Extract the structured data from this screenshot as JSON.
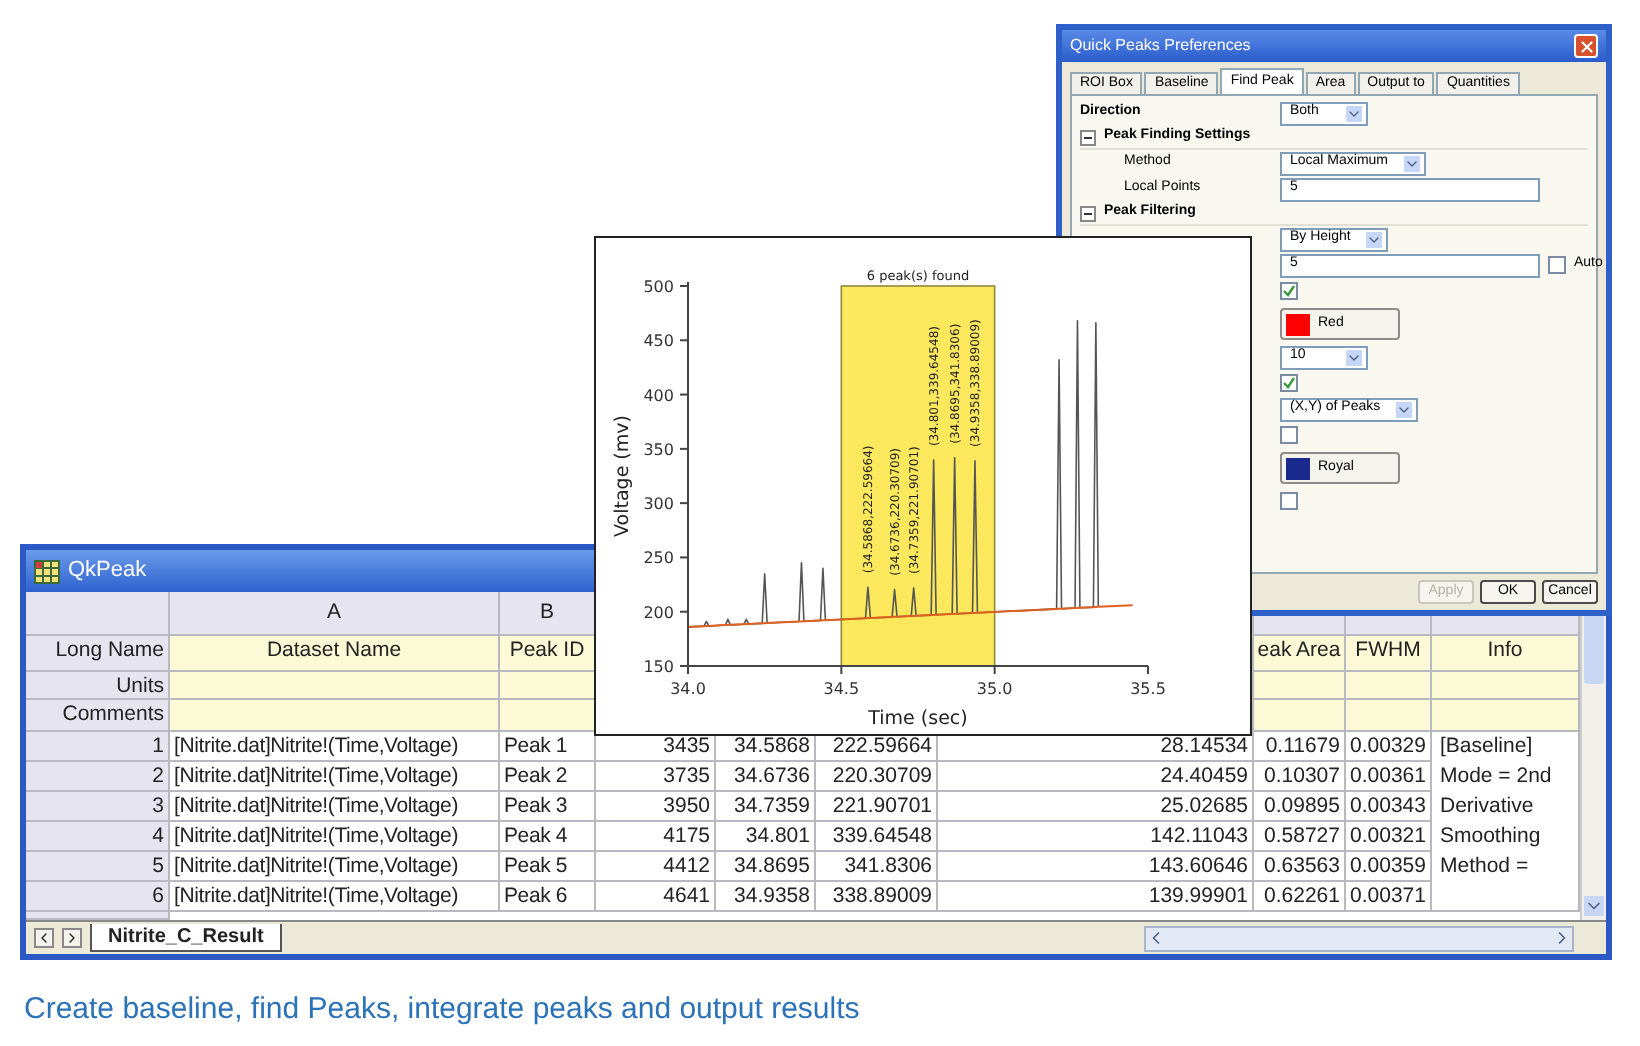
{
  "worksheet": {
    "title": "QkPeak",
    "left_columns": [
      {
        "letter": "A",
        "long_name": "Dataset Name"
      },
      {
        "letter": "B",
        "long_name": "Peak ID"
      }
    ],
    "right_columns": [
      {
        "long_name": "eak Area"
      },
      {
        "long_name": "FWHM"
      },
      {
        "long_name": "Info"
      }
    ],
    "row_labels": [
      "Long Name",
      "Units",
      "Comments"
    ],
    "rows": [
      {
        "number": "1",
        "cells": [
          "[Nitrite.dat]Nitrite!(Time,Voltage)",
          "Peak 1",
          "3435",
          "34.5868",
          "222.59664",
          "28.14534",
          "0.11679",
          "0.00329"
        ]
      },
      {
        "number": "2",
        "cells": [
          "[Nitrite.dat]Nitrite!(Time,Voltage)",
          "Peak 2",
          "3735",
          "34.6736",
          "220.30709",
          "24.40459",
          "0.10307",
          "0.00361"
        ]
      },
      {
        "number": "3",
        "cells": [
          "[Nitrite.dat]Nitrite!(Time,Voltage)",
          "Peak 3",
          "3950",
          "34.7359",
          "221.90701",
          "25.02685",
          "0.09895",
          "0.00343"
        ]
      },
      {
        "number": "4",
        "cells": [
          "[Nitrite.dat]Nitrite!(Time,Voltage)",
          "Peak 4",
          "4175",
          "34.801",
          "339.64548",
          "142.11043",
          "0.58727",
          "0.00321"
        ]
      },
      {
        "number": "5",
        "cells": [
          "[Nitrite.dat]Nitrite!(Time,Voltage)",
          "Peak 5",
          "4412",
          "34.8695",
          "341.8306",
          "143.60646",
          "0.63563",
          "0.00359"
        ]
      },
      {
        "number": "6",
        "cells": [
          "[Nitrite.dat]Nitrite!(Time,Voltage)",
          "Peak 6",
          "4641",
          "34.9358",
          "338.89009",
          "139.99901",
          "0.62261",
          "0.00371"
        ]
      }
    ],
    "info_note": "[Baseline] Mode = 2nd Derivative Smoothing Method =",
    "sheet_tab": "Nitrite_C_Result"
  },
  "dialog": {
    "title": "Quick Peaks Preferences",
    "tabs": [
      {
        "label": "ROI Box",
        "selected": false
      },
      {
        "label": "Baseline",
        "selected": false
      },
      {
        "label": "Find Peak",
        "selected": true
      },
      {
        "label": "Area",
        "selected": false
      },
      {
        "label": "Output to",
        "selected": false
      },
      {
        "label": "Quantities",
        "selected": false
      }
    ],
    "rows": [
      {
        "kind": "dropdown",
        "label": "Direction",
        "value": "Both"
      },
      {
        "kind": "section",
        "label": "Peak Finding Settings",
        "expanded": true,
        "children": [
          {
            "kind": "dropdown",
            "label": "Method",
            "value": "Local Maximum"
          },
          {
            "kind": "text_field",
            "label": "Local Points",
            "value": "5"
          }
        ]
      },
      {
        "kind": "section",
        "label": "Peak Filtering",
        "expanded": true,
        "children": [
          {
            "kind": "dropdown",
            "value": "By Height"
          },
          {
            "kind": "text_field",
            "value": "5",
            "option": {
              "label": "Auto",
              "checked": false
            }
          },
          {
            "kind": "checkbox",
            "checked": true
          },
          {
            "kind": "color",
            "value": "Red",
            "color": "#ff0000"
          },
          {
            "kind": "dropdown",
            "value": "10"
          },
          {
            "kind": "checkbox",
            "checked": true
          },
          {
            "kind": "dropdown",
            "value": "(X,Y) of Peaks"
          },
          {
            "kind": "checkbox",
            "checked": false
          },
          {
            "kind": "color",
            "value": "Royal",
            "color": "#1a2a8c"
          },
          {
            "kind": "checkbox",
            "checked": false
          }
        ]
      }
    ],
    "buttons": [
      {
        "label": "Apply",
        "disabled": true
      },
      {
        "label": "OK",
        "disabled": false
      },
      {
        "label": "Cancel",
        "disabled": false
      }
    ]
  },
  "chart": {
    "chart_data": {
      "type": "line",
      "title": "6 peak(s) found",
      "xlabel": "Time (sec)",
      "ylabel": "Voltage (mv)",
      "x": [
        34.0,
        34.052,
        34.06,
        34.068,
        34.122,
        34.13,
        34.138,
        34.182,
        34.19,
        34.198,
        34.242,
        34.25,
        34.258,
        34.362,
        34.37,
        34.378,
        34.432,
        34.44,
        34.448,
        34.5788,
        34.5868,
        34.5948,
        34.6656,
        34.6736,
        34.6816,
        34.7279,
        34.7359,
        34.7439,
        34.793,
        34.801,
        34.809,
        34.8615,
        34.8695,
        34.8775,
        34.9278,
        34.9358,
        34.9438,
        35.202,
        35.21,
        35.218,
        35.262,
        35.27,
        35.278,
        35.322,
        35.33,
        35.338,
        35.45
      ],
      "series": [
        {
          "color": "#555555",
          "values": [
            186.0,
            186.7,
            191,
            186.9,
            187.7,
            193,
            187.9,
            188.5,
            193,
            188.7,
            189.3,
            235,
            189.6,
            191.0,
            245,
            191.2,
            192.0,
            240,
            192.2,
            194.0,
            222.59664,
            194.2,
            195.2,
            220.30709,
            195.4,
            196.0,
            221.90701,
            196.3,
            196.9,
            339.64548,
            197.2,
            197.9,
            341.8306,
            198.1,
            198.8,
            338.89009,
            199.0,
            202.6,
            432,
            202.8,
            203.4,
            468,
            203.6,
            204.2,
            466,
            204.5,
            null
          ]
        },
        {
          "color": "#e0601e",
          "values": [
            186.0,
            186.7,
            186.8,
            186.9,
            187.7,
            187.8,
            187.9,
            188.5,
            188.6,
            188.7,
            189.3,
            189.4,
            189.6,
            191.0,
            191.1,
            191.2,
            192.0,
            192.1,
            192.2,
            194.0,
            194.1,
            194.2,
            195.2,
            195.3,
            195.4,
            196.0,
            196.1,
            196.3,
            196.9,
            197.0,
            197.2,
            197.9,
            198.0,
            198.1,
            198.8,
            198.9,
            199.0,
            202.6,
            202.7,
            202.8,
            203.4,
            203.5,
            203.6,
            204.2,
            204.4,
            204.5,
            206.0
          ]
        }
      ],
      "bands": [
        {
          "axis": "x",
          "from": 34.5,
          "to": 35.0,
          "color": "#fbe85c"
        }
      ],
      "xlim": [
        34.0,
        35.5
      ],
      "ylim": [
        150,
        500
      ],
      "xticks": [
        {
          "value": 34.0,
          "label": "34.0"
        },
        {
          "value": 34.5,
          "label": "34.5"
        },
        {
          "value": 35.0,
          "label": "35.0"
        },
        {
          "value": 35.5,
          "label": "35.5"
        }
      ],
      "yticks": [
        150,
        200,
        250,
        300,
        350,
        400,
        450,
        500
      ],
      "annotations": [
        {
          "x": 34.5868,
          "y": 222.59664,
          "text": "(34.5868,222.59664)"
        },
        {
          "x": 34.6736,
          "y": 220.30709,
          "text": "(34.6736,220.30709)"
        },
        {
          "x": 34.7359,
          "y": 221.90701,
          "text": "(34.7359,221.90701)"
        },
        {
          "x": 34.801,
          "y": 339.64548,
          "text": "(34.801,339.64548)"
        },
        {
          "x": 34.8695,
          "y": 341.8306,
          "text": "(34.8695,341.8306)"
        },
        {
          "x": 34.9358,
          "y": 338.89009,
          "text": "(34.9358,338.89009)"
        }
      ]
    }
  },
  "caption": "Create baseline, find Peaks, integrate peaks and output results"
}
